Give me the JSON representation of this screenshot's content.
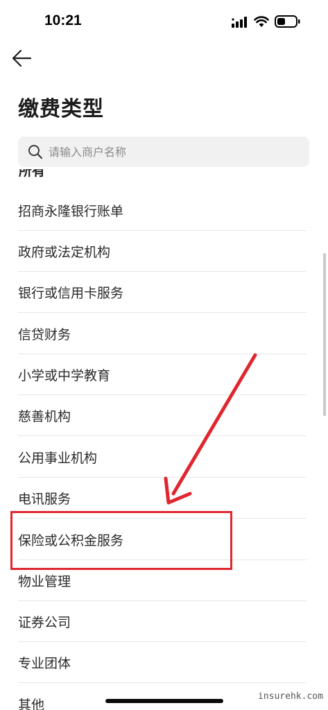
{
  "status_bar": {
    "time": "10:21",
    "icons": [
      "signal-icon",
      "wifi-icon",
      "battery-icon"
    ]
  },
  "nav": {
    "back_icon": "arrow-left-icon"
  },
  "page": {
    "title": "缴费类型"
  },
  "search": {
    "placeholder": "请输入商户名称",
    "value": ""
  },
  "list": {
    "section_header": "所有",
    "items": [
      {
        "label": "招商永隆银行账单"
      },
      {
        "label": "政府或法定机构"
      },
      {
        "label": "银行或信用卡服务"
      },
      {
        "label": "信贷财务"
      },
      {
        "label": "小学或中学教育"
      },
      {
        "label": "慈善机构"
      },
      {
        "label": "公用事业机构"
      },
      {
        "label": "电讯服务"
      },
      {
        "label": "保险或公积金服务"
      },
      {
        "label": "物业管理"
      },
      {
        "label": "证券公司"
      },
      {
        "label": "专业团体"
      },
      {
        "label": "其他"
      }
    ]
  },
  "annotation": {
    "highlighted_item": "保险或公积金服务",
    "color": "#e0262f"
  },
  "watermark": "insurehk.com",
  "colors": {
    "background": "#ffffff",
    "search_bg": "#f1f1f2",
    "divider": "#e6e6e6",
    "annotation": "#e0262f"
  }
}
